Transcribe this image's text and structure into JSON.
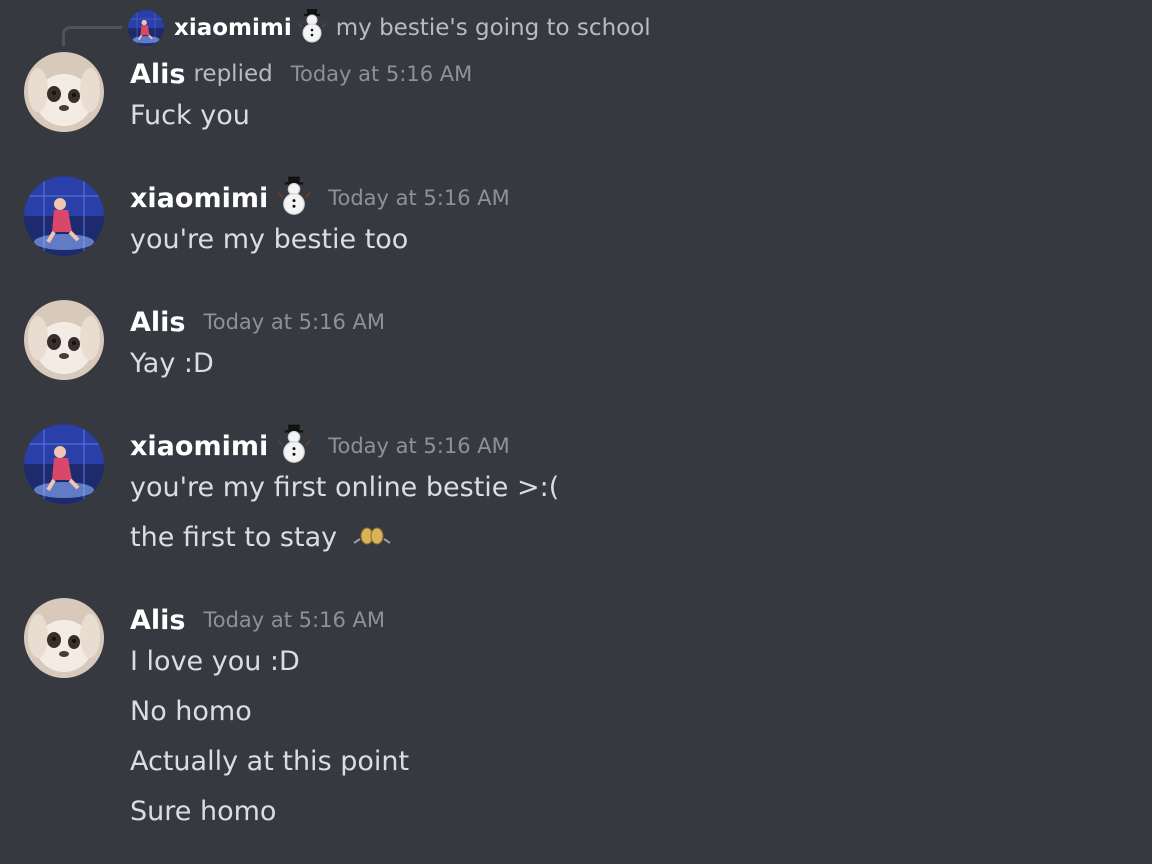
{
  "reply_reference": {
    "author": "xiaomimi",
    "author_badge": "snowman-emoji",
    "preview": "my bestie's going to school"
  },
  "messages": [
    {
      "author": "Alis",
      "replied_label": "replied",
      "timestamp": "Today at 5:16 AM",
      "avatar": "bunny-avatar",
      "lines": [
        "Fuck you"
      ]
    },
    {
      "author": "xiaomimi",
      "author_badge": "snowman-emoji",
      "timestamp": "Today at 5:16 AM",
      "avatar": "dancer-avatar",
      "lines": [
        "you're my bestie too"
      ]
    },
    {
      "author": "Alis",
      "timestamp": "Today at 5:16 AM",
      "avatar": "bunny-avatar",
      "lines": [
        "Yay :D"
      ]
    },
    {
      "author": "xiaomimi",
      "author_badge": "snowman-emoji",
      "timestamp": "Today at 5:16 AM",
      "avatar": "dancer-avatar",
      "lines": [
        "you're my first online bestie >:(",
        "the first to stay"
      ],
      "line_emoji": "pleading-hands-emoji"
    },
    {
      "author": "Alis",
      "timestamp": "Today at 5:16 AM",
      "avatar": "bunny-avatar",
      "lines": [
        "I love you :D",
        "No homo",
        "Actually at this point",
        "Sure homo"
      ]
    }
  ],
  "colors": {
    "background": "#36393f",
    "username": "#ffffff",
    "message_text": "#dcddde",
    "timestamp": "#8e9297",
    "reply_line": "#4f545c"
  }
}
